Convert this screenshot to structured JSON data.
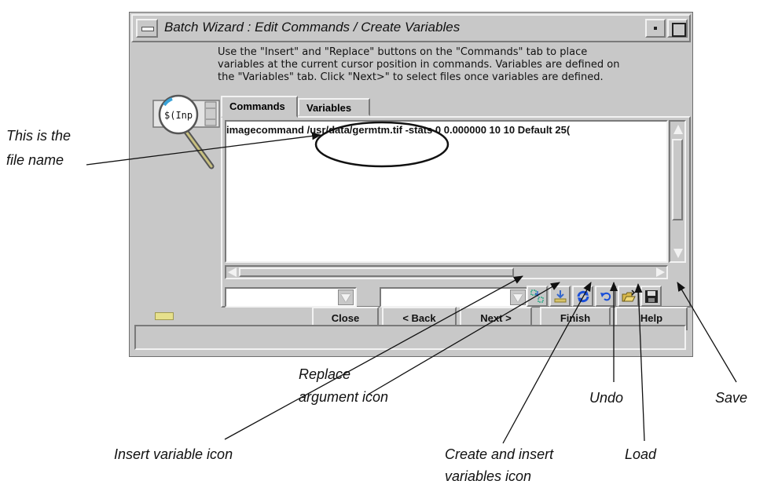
{
  "window": {
    "title": "Batch Wizard : Edit Commands / Create Variables",
    "instructions": [
      "Use the \"Insert\" and \"Replace\" buttons on the \"Commands\" tab to place",
      "variables at the current cursor position in commands. Variables are defined on",
      "the \"Variables\" tab. Click \"Next>\" to select files once variables are defined."
    ],
    "wizard_icon_text": "$(Inp",
    "tabs": [
      {
        "label": "Commands",
        "active": true
      },
      {
        "label": "Variables",
        "active": false
      }
    ],
    "command_text": {
      "prefix": "imagecommand",
      "filename": "/usr/data/germtm.tif",
      "suffix": "-stats 0 0.000000 10 10 Default 25("
    },
    "toolbar_icons": [
      {
        "name": "insert-variable-icon"
      },
      {
        "name": "replace-argument-icon"
      },
      {
        "name": "create-and-insert-variables-icon"
      },
      {
        "name": "undo-icon"
      },
      {
        "name": "load-icon"
      },
      {
        "name": "save-icon"
      }
    ],
    "buttons": {
      "close": "Close",
      "back": "< Back",
      "next": "Next >",
      "finish": "Finish",
      "help": "Help"
    }
  },
  "annotations": {
    "file_name": [
      "This is the",
      "file name"
    ],
    "replace_argument": [
      "Replace",
      "argument icon"
    ],
    "insert_variable": "Insert variable icon",
    "create_insert": [
      "Create and insert",
      "variables icon"
    ],
    "undo": "Undo",
    "load": "Load",
    "save": "Save"
  },
  "colors": {
    "window_bg": "#c8c8c8",
    "text_bg": "#ffffff",
    "accent_blue": "#1a4fd8"
  }
}
